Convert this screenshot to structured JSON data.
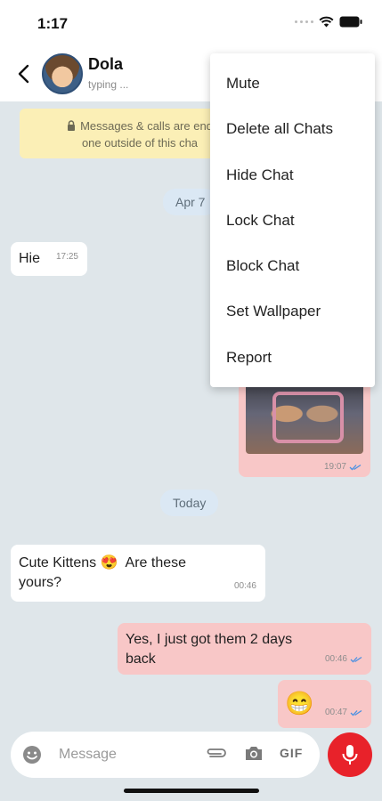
{
  "status_bar": {
    "time": "1:17"
  },
  "header": {
    "contact_name": "Dola",
    "contact_status": "typing ..."
  },
  "encryption_note": {
    "line1": "Messages & calls are end",
    "line2": "one outside of this cha"
  },
  "date_separators": [
    "Apr 7",
    "Today"
  ],
  "messages": [
    {
      "direction": "in",
      "text": "Hie",
      "time": "17:25"
    },
    {
      "direction": "out",
      "type": "image",
      "time": "19:07",
      "read": true
    },
    {
      "direction": "in",
      "text": "Cute Kittens 😍  Are these yours?",
      "time": "00:46"
    },
    {
      "direction": "out",
      "text": "Yes, I just got them 2 days back",
      "time": "00:46",
      "read": true
    },
    {
      "direction": "out",
      "text": "😁",
      "time": "00:47",
      "read": true
    }
  ],
  "menu": {
    "items": [
      "Mute",
      "Delete all Chats",
      "Hide Chat",
      "Lock Chat",
      "Block Chat",
      "Set Wallpaper",
      "Report"
    ]
  },
  "composer": {
    "placeholder": "Message",
    "gif_label": "GIF"
  },
  "icons": {
    "back": "back-arrow-icon",
    "lock": "lock-icon",
    "emoji": "emoji-icon",
    "attach": "paperclip-icon",
    "camera": "camera-icon",
    "mic": "mic-icon",
    "read_receipt": "double-check-icon"
  },
  "colors": {
    "incoming_bubble": "#ffffff",
    "outgoing_bubble": "#f8c7c7",
    "note_background": "#fbefb6",
    "mic_button": "#e8222a",
    "read_tick": "#4a90e2"
  }
}
